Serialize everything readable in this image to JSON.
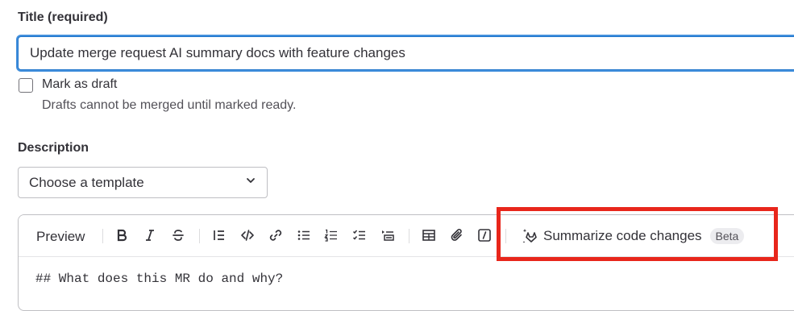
{
  "title_field": {
    "label": "Title (required)",
    "value": "Update merge request AI summary docs with feature changes"
  },
  "draft": {
    "label": "Mark as draft",
    "help": "Drafts cannot be merged until marked ready.",
    "checked": false
  },
  "description": {
    "label": "Description",
    "template_select": "Choose a template"
  },
  "editor": {
    "preview_tab": "Preview",
    "toolbar_icons": [
      "bold-icon",
      "italic-icon",
      "strikethrough-icon",
      "quote-icon",
      "code-icon",
      "link-icon",
      "bullet-list-icon",
      "numbered-list-icon",
      "task-list-icon",
      "collapsible-icon",
      "table-icon",
      "attachment-icon",
      "slash-command-icon"
    ],
    "summarize_label": "Summarize code changes",
    "beta_badge": "Beta",
    "content_first_line": "## What does this MR do and why?"
  },
  "highlight_color": "#e8261b",
  "accent_color": "#1f75cb"
}
